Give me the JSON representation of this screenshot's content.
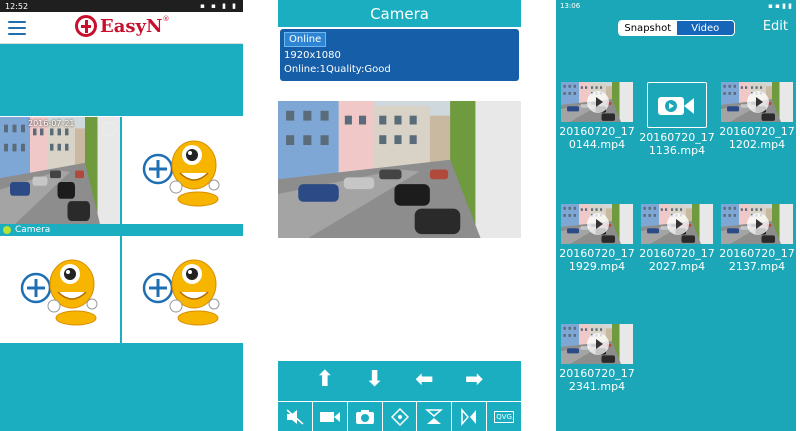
{
  "screen1": {
    "status_time": "12:52",
    "status_icons": "▪ ▪ ▮ ▮",
    "logo_text": "EasyN",
    "logo_reg": "®",
    "camera_timestamp": "2016-07-21",
    "camera_label": "Camera",
    "add_icon": "plus-circle-icon"
  },
  "screen2": {
    "title": "Camera",
    "status_badge": "Online",
    "resolution": "1920x1080",
    "status_line": "Online:1Quality:Good",
    "qvga_label": "QVG"
  },
  "screen3": {
    "status_time": "13:06",
    "status_icons": "▪ ▪ ▮ ▮",
    "tab_snapshot": "Snapshot",
    "tab_video": "Video",
    "edit_label": "Edit",
    "files": [
      {
        "name_line1": "20160720_17",
        "name_line2": "0144.mp4"
      },
      {
        "name_line1": "20160720_17",
        "name_line2": "1136.mp4"
      },
      {
        "name_line1": "20160720_17",
        "name_line2": "1202.mp4"
      },
      {
        "name_line1": "20160720_17",
        "name_line2": "1929.mp4"
      },
      {
        "name_line1": "20160720_17",
        "name_line2": "2027.mp4"
      },
      {
        "name_line1": "20160720_17",
        "name_line2": "2137.mp4"
      },
      {
        "name_line1": "20160720_17",
        "name_line2": "2341.mp4"
      }
    ]
  },
  "colors": {
    "teal": "#1aaec0",
    "dark_blue": "#165ea8",
    "brand_red": "#c8102e",
    "online_dot": "#b6e232"
  }
}
